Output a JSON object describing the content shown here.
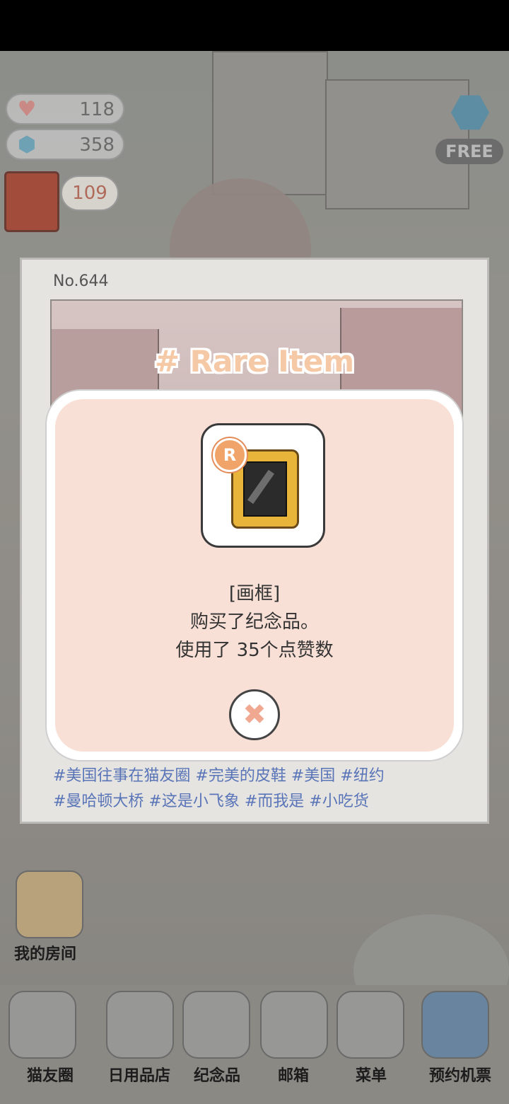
{
  "currencies": {
    "hearts": "118",
    "gems": "358",
    "badge": "109"
  },
  "free_label": "FREE",
  "card": {
    "number": "No.644",
    "tags_line1": "#美国往事在猫友圈 #完美的皮鞋 #美国 #纽约",
    "tags_line2": "#曼哈顿大桥 #这是小飞象 #而我是 #小吃货"
  },
  "rare_title": "# Rare Item",
  "dialog": {
    "rarity_badge": "R",
    "item_name": "[画框]",
    "line1": "购买了纪念品。",
    "line2": "使用了 35个点赞数",
    "close_glyph": "✖"
  },
  "room_label": "我的房间",
  "nav": {
    "items": [
      {
        "label": "猫友圈"
      },
      {
        "label": "日用品店"
      },
      {
        "label": "纪念品"
      },
      {
        "label": "邮箱"
      },
      {
        "label": "菜单"
      },
      {
        "label": "预约机票"
      }
    ]
  }
}
